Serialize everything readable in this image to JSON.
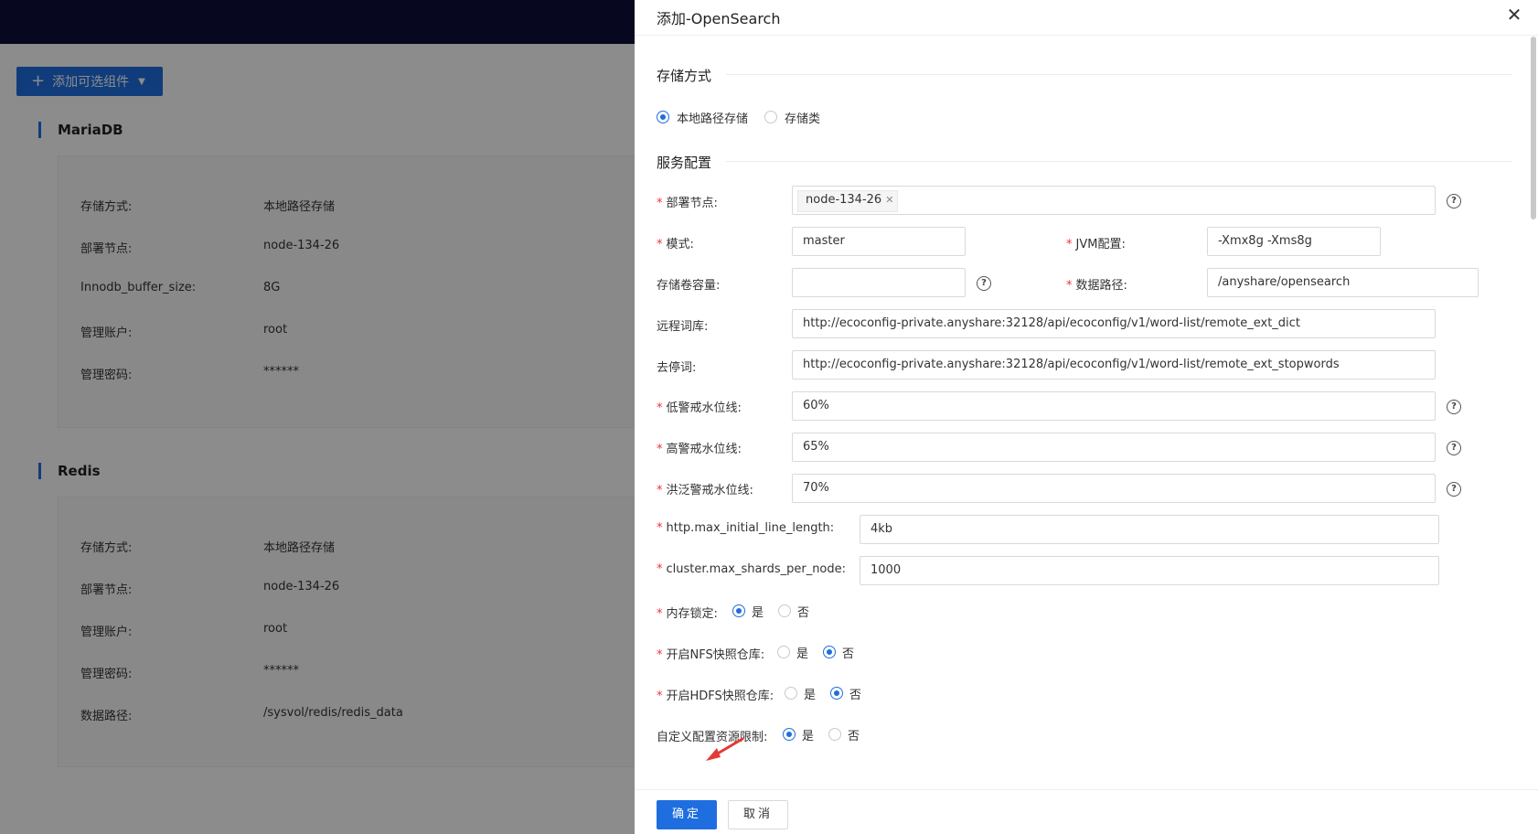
{
  "background": {
    "add_button_label": "添加可选组件",
    "sections": [
      {
        "title": "MariaDB",
        "rows": [
          {
            "label": "存储方式:",
            "value": "本地路径存储"
          },
          {
            "label": "部署节点:",
            "value": "node-134-26"
          },
          {
            "label": "Innodb_buffer_size:",
            "value": "8G"
          },
          {
            "label": "管理账户:",
            "value": "root"
          },
          {
            "label": "管理密码:",
            "value": "******"
          }
        ]
      },
      {
        "title": "Redis",
        "rows": [
          {
            "label": "存储方式:",
            "value": "本地路径存储"
          },
          {
            "label": "部署节点:",
            "value": "node-134-26"
          },
          {
            "label": "管理账户:",
            "value": "root"
          },
          {
            "label": "管理密码:",
            "value": "******"
          },
          {
            "label": "数据路径:",
            "value": "/sysvol/redis/redis_data"
          }
        ]
      }
    ]
  },
  "drawer": {
    "title": "添加-OpenSearch",
    "storage_group": "存储方式",
    "storage_options": [
      "本地路径存储",
      "存储类"
    ],
    "service_group": "服务配置",
    "fields": {
      "deploy_node": {
        "label": "部署节点:",
        "tag": "node-134-26"
      },
      "mode": {
        "label": "模式:",
        "value": "master"
      },
      "jvm": {
        "label": "JVM配置:",
        "value": "-Xmx8g -Xms8g"
      },
      "volume": {
        "label": "存储卷容量:",
        "value": ""
      },
      "data_path": {
        "label": "数据路径:",
        "value": "/anyshare/opensearch"
      },
      "remote_dict": {
        "label": "远程词库:",
        "value": "http://ecoconfig-private.anyshare:32128/api/ecoconfig/v1/word-list/remote_ext_dict"
      },
      "stopwords": {
        "label": "去停词:",
        "value": "http://ecoconfig-private.anyshare:32128/api/ecoconfig/v1/word-list/remote_ext_stopwords"
      },
      "low_watermark": {
        "label": "低警戒水位线:",
        "value": "60%"
      },
      "high_watermark": {
        "label": "高警戒水位线:",
        "value": "65%"
      },
      "flood_watermark": {
        "label": "洪泛警戒水位线:",
        "value": "70%"
      },
      "max_line_length": {
        "label": "http.max_initial_line_length:",
        "value": "4kb"
      },
      "max_shards": {
        "label": "cluster.max_shards_per_node:",
        "value": "1000"
      },
      "mem_lock": {
        "label": "内存锁定:"
      },
      "nfs": {
        "label": "开启NFS快照仓库:"
      },
      "hdfs": {
        "label": "开启HDFS快照仓库:"
      },
      "resource_limit": {
        "label": "自定义配置资源限制:"
      }
    },
    "yes": "是",
    "no": "否",
    "ok_label": "确定",
    "cancel_label": "取消"
  },
  "colors": {
    "accent": "#1e6ee0",
    "header": "#0d0f3a",
    "required": "#e33333"
  }
}
